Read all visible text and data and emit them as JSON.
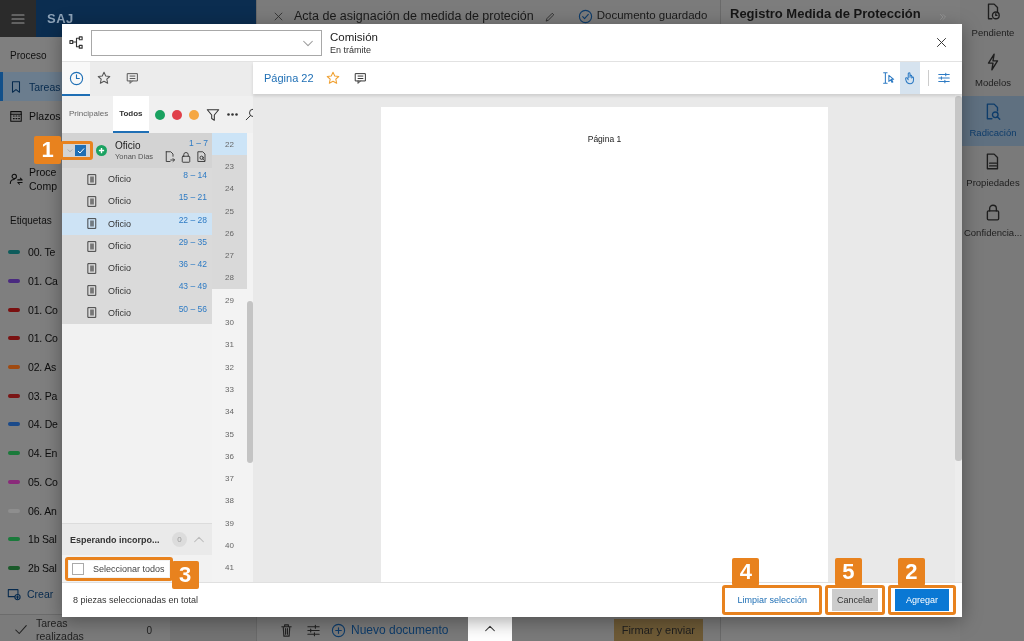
{
  "app": {
    "name": "SAJ"
  },
  "sidebar": {
    "section": "Proceso",
    "items": [
      {
        "label": "Tareas",
        "selected": true
      },
      {
        "label": "Plazos",
        "selected": false
      },
      {
        "label": "Proce",
        "subtitle": "Comp",
        "selected": false
      }
    ],
    "tags_title": "Etiquetas",
    "tags": [
      {
        "label": "00. Te",
        "color": "#0e5c5c"
      },
      {
        "label": "01. Ca",
        "color": "#4a2a80"
      },
      {
        "label": "01. Co",
        "color": "#7a1010"
      },
      {
        "label": "01. Co",
        "color": "#7a1212"
      },
      {
        "label": "02. As",
        "color": "#a04a10"
      },
      {
        "label": "03. Pa",
        "color": "#7a1515"
      },
      {
        "label": "04. De",
        "color": "#1a4a8a"
      },
      {
        "label": "04. En",
        "color": "#1a7a3a"
      },
      {
        "label": "05. Co",
        "color": "#8a2a7a"
      },
      {
        "label": "06. An",
        "color": "#8e8e8e"
      },
      {
        "label": "1b Sal",
        "color": "#1a7a3b"
      },
      {
        "label": "2b Sal",
        "color": "#1a5a2a"
      }
    ],
    "create": "Crear",
    "done": {
      "label": "Tareas realizadas",
      "count": "0"
    }
  },
  "document": {
    "title": "Acta de asignación de medida de proteción",
    "status": "Documento guardado",
    "new_document": "Nuevo documento",
    "sign": "Firmar y enviar"
  },
  "right_panel": {
    "title": "Registro Medida de Protección"
  },
  "rail": [
    {
      "label": "Pendiente",
      "selected": false
    },
    {
      "label": "Modelos",
      "selected": false
    },
    {
      "label": "Radicación",
      "selected": true
    },
    {
      "label": "Propiedades",
      "selected": false
    },
    {
      "label": "Confidencia...",
      "selected": false
    }
  ],
  "modal": {
    "status_title": "Comisión",
    "status_subtitle": "En trámite",
    "panel_tabs": [
      {
        "kind": "history",
        "selected": true
      },
      {
        "kind": "favorites",
        "selected": false
      },
      {
        "kind": "comments",
        "selected": false
      }
    ],
    "list_tabs": [
      {
        "label": "Principales",
        "selected": false
      },
      {
        "label": "Todos",
        "selected": true
      }
    ],
    "tree": [
      {
        "title": "Oficio",
        "author": "Yonan Dias",
        "pages": "1 – 7",
        "checked": true,
        "expanded": true,
        "callout": "1",
        "children": [
          {
            "title": "Oficio",
            "pages": "8 – 14",
            "selected": false
          },
          {
            "title": "Oficio",
            "pages": "15 – 21",
            "selected": false
          },
          {
            "title": "Oficio",
            "pages": "22 – 28",
            "selected": true
          },
          {
            "title": "Oficio",
            "pages": "29 – 35",
            "selected": false
          },
          {
            "title": "Oficio",
            "pages": "36 – 42",
            "selected": false
          },
          {
            "title": "Oficio",
            "pages": "43 – 49",
            "selected": false
          },
          {
            "title": "Oficio",
            "pages": "50 – 56",
            "selected": false
          }
        ]
      }
    ],
    "page_numbers": [
      {
        "label": "22",
        "selected": true,
        "in_piece": true
      },
      {
        "label": "23",
        "selected": false,
        "in_piece": true
      },
      {
        "label": "24",
        "selected": false,
        "in_piece": true
      },
      {
        "label": "25",
        "selected": false,
        "in_piece": true
      },
      {
        "label": "26",
        "selected": false,
        "in_piece": true
      },
      {
        "label": "27",
        "selected": false,
        "in_piece": true
      },
      {
        "label": "28",
        "selected": false,
        "in_piece": true
      },
      {
        "label": "29",
        "selected": false,
        "in_piece": false
      },
      {
        "label": "30",
        "selected": false,
        "in_piece": false
      },
      {
        "label": "31",
        "selected": false,
        "in_piece": false
      },
      {
        "label": "32",
        "selected": false,
        "in_piece": false
      },
      {
        "label": "33",
        "selected": false,
        "in_piece": false
      },
      {
        "label": "34",
        "selected": false,
        "in_piece": false
      },
      {
        "label": "35",
        "selected": false,
        "in_piece": false
      },
      {
        "label": "36",
        "selected": false,
        "in_piece": false
      },
      {
        "label": "37",
        "selected": false,
        "in_piece": false
      },
      {
        "label": "38",
        "selected": false,
        "in_piece": false
      },
      {
        "label": "39",
        "selected": false,
        "in_piece": false
      },
      {
        "label": "40",
        "selected": false,
        "in_piece": false
      },
      {
        "label": "41",
        "selected": false,
        "in_piece": false
      }
    ],
    "pending": {
      "label": "Esperando incorpo...",
      "count": "0",
      "expanded": false
    },
    "select_all": {
      "label": "Seleccionar todos",
      "checked": false,
      "callout": "3"
    },
    "viewer": {
      "page_label": "Página 22",
      "favorite": false,
      "tools": [
        {
          "kind": "text-select",
          "selected": false
        },
        {
          "kind": "hand",
          "selected": true
        }
      ],
      "document_page": "Página 1"
    },
    "footer": {
      "summary": "8 piezas seleccionadas en total",
      "buttons": [
        {
          "label": "Limpiar selección",
          "kind": "link",
          "callout": "4"
        },
        {
          "label": "Cancelar",
          "kind": "secondary",
          "callout": "5"
        },
        {
          "label": "Agregar",
          "kind": "primary",
          "callout": "2"
        }
      ]
    }
  }
}
